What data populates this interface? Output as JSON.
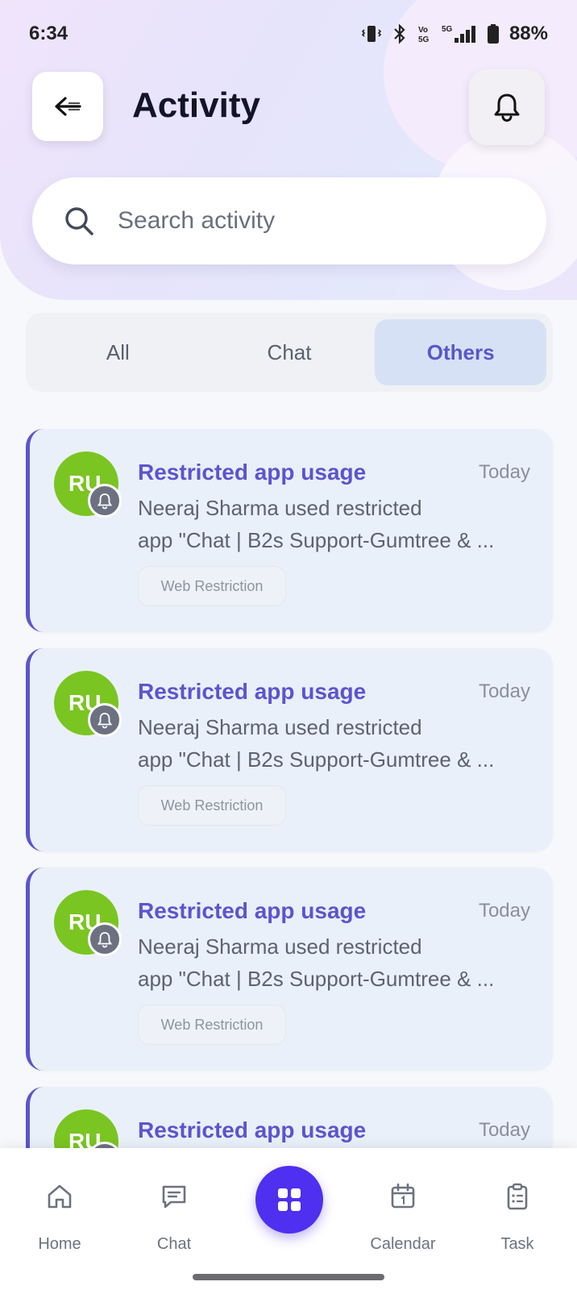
{
  "status_bar": {
    "time": "6:34",
    "network": "5G",
    "battery": "88%"
  },
  "header": {
    "title": "Activity",
    "back_icon": "arrow-left-icon",
    "notification_icon": "bell-icon"
  },
  "search": {
    "placeholder": "Search activity",
    "value": ""
  },
  "tabs": [
    {
      "label": "All",
      "active": false
    },
    {
      "label": "Chat",
      "active": false
    },
    {
      "label": "Others",
      "active": true
    }
  ],
  "activities": [
    {
      "avatar_initials": "RU",
      "title": "Restricted app usage",
      "time": "Today",
      "desc_line1": "Neeraj Sharma used restricted",
      "desc_line2": "app \"Chat | B2s Support-Gumtree & ...",
      "tag": "Web Restriction"
    },
    {
      "avatar_initials": "RU",
      "title": "Restricted app usage",
      "time": "Today",
      "desc_line1": "Neeraj Sharma used restricted",
      "desc_line2": "app \"Chat | B2s Support-Gumtree & ...",
      "tag": "Web Restriction"
    },
    {
      "avatar_initials": "RU",
      "title": "Restricted app usage",
      "time": "Today",
      "desc_line1": "Neeraj Sharma used restricted",
      "desc_line2": "app \"Chat | B2s Support-Gumtree & ...",
      "tag": "Web Restriction"
    },
    {
      "avatar_initials": "RU",
      "title": "Restricted app usage",
      "time": "Today",
      "desc_line1": "",
      "desc_line2": "",
      "tag": ""
    }
  ],
  "bottom_nav": {
    "home": "Home",
    "chat": "Chat",
    "calendar": "Calendar",
    "task": "Task",
    "center_icon": "grid-icon"
  },
  "colors": {
    "accent": "#5c54cf",
    "nav_center": "#4f2ff0",
    "avatar": "#7ac521",
    "card_bg": "#eaf0fa"
  }
}
